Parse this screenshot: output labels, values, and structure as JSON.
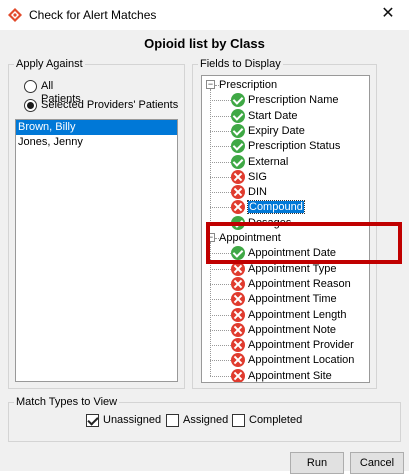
{
  "window": {
    "title": "Check for Alert Matches",
    "close_glyph": "✕"
  },
  "heading": "Opioid list by Class",
  "apply_against": {
    "label": "Apply Against",
    "options": [
      "All Patients",
      "Selected Providers' Patients"
    ],
    "selected_option": "Selected Providers' Patients",
    "patients": [
      "Brown, Billy",
      "Jones, Jenny"
    ],
    "selected_patient": "Brown, Billy"
  },
  "fields": {
    "label": "Fields to Display",
    "groups": [
      {
        "name": "Prescription",
        "items": [
          {
            "label": "Prescription Name",
            "status": "check"
          },
          {
            "label": "Start Date",
            "status": "check"
          },
          {
            "label": "Expiry Date",
            "status": "check"
          },
          {
            "label": "Prescription Status",
            "status": "check"
          },
          {
            "label": "External",
            "status": "check"
          },
          {
            "label": "SIG",
            "status": "x"
          },
          {
            "label": "DIN",
            "status": "x"
          },
          {
            "label": "Compound",
            "status": "x",
            "highlighted": true
          },
          {
            "label": "Dosages",
            "status": "check"
          }
        ]
      },
      {
        "name": "Appointment",
        "items": [
          {
            "label": "Appointment Date",
            "status": "check"
          },
          {
            "label": "Appointment Type",
            "status": "x"
          },
          {
            "label": "Appointment Reason",
            "status": "x"
          },
          {
            "label": "Appointment Time",
            "status": "x"
          },
          {
            "label": "Appointment Length",
            "status": "x"
          },
          {
            "label": "Appointment Note",
            "status": "x"
          },
          {
            "label": "Appointment Provider",
            "status": "x"
          },
          {
            "label": "Appointment Location",
            "status": "x"
          },
          {
            "label": "Appointment Site",
            "status": "x"
          }
        ]
      }
    ]
  },
  "match_types": {
    "label": "Match Types to View",
    "options": [
      {
        "label": "Unassigned",
        "checked": true
      },
      {
        "label": "Assigned",
        "checked": false
      },
      {
        "label": "Completed",
        "checked": false
      }
    ]
  },
  "buttons": {
    "run": "Run",
    "cancel": "Cancel"
  },
  "colors": {
    "selection": "#0078d7",
    "check": "#3fa845",
    "x": "#e03b2e",
    "highlight_box": "#c00000"
  }
}
